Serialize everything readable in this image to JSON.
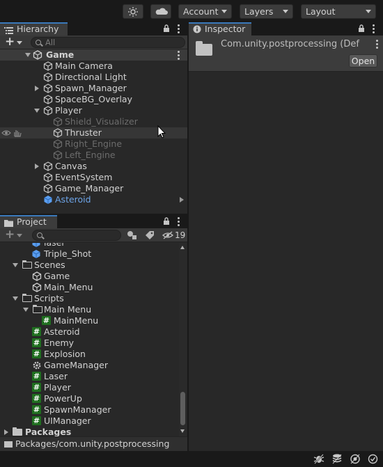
{
  "toolbar": {
    "account_label": "Account",
    "layers_label": "Layers",
    "layout_label": "Layout",
    "icons": [
      "light-icon",
      "cloud-icon"
    ]
  },
  "hierarchy": {
    "tab_label": "Hierarchy",
    "search_placeholder": "All",
    "scene_name": "Game",
    "items": [
      {
        "label": "Main Camera"
      },
      {
        "label": "Directional Light"
      },
      {
        "label": "Spawn_Manager"
      },
      {
        "label": "SpaceBG_Overlay"
      },
      {
        "label": "Player"
      },
      {
        "label": "Shield_Visualizer"
      },
      {
        "label": "Thruster"
      },
      {
        "label": "Right_Engine"
      },
      {
        "label": "Left_Engine"
      },
      {
        "label": "Canvas"
      },
      {
        "label": "EventSystem"
      },
      {
        "label": "Game_Manager"
      },
      {
        "label": "Asteroid"
      }
    ]
  },
  "inspector": {
    "tab_label": "Inspector",
    "asset_title": "Com.unity.postprocessing (Def",
    "open_button": "Open"
  },
  "project": {
    "tab_label": "Project",
    "hidden_count": "19",
    "items": [
      {
        "label": "laser"
      },
      {
        "label": "Triple_Shot"
      },
      {
        "label": "Scenes"
      },
      {
        "label": "Game"
      },
      {
        "label": "Main_Menu"
      },
      {
        "label": "Scripts"
      },
      {
        "label": "Main Menu"
      },
      {
        "label": "MainMenu"
      },
      {
        "label": "Asteroid"
      },
      {
        "label": "Enemy"
      },
      {
        "label": "Explosion"
      },
      {
        "label": "GameManager"
      },
      {
        "label": "Laser"
      },
      {
        "label": "Player"
      },
      {
        "label": "PowerUp"
      },
      {
        "label": "SpawnManager"
      },
      {
        "label": "UIManager"
      },
      {
        "label": "Packages"
      }
    ],
    "path": "Packages/com.unity.postprocessing"
  },
  "colors": {
    "accent": "#3a79bb",
    "script_icon": "#1f6e1f",
    "prefab_text": "#6da4e8"
  }
}
